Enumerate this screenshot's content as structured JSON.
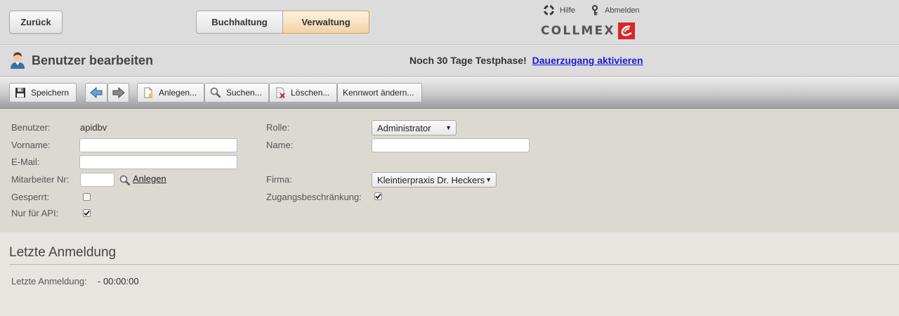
{
  "header": {
    "back_label": "Zurück",
    "tabs": [
      {
        "label": "Buchhaltung",
        "active": false
      },
      {
        "label": "Verwaltung",
        "active": true
      }
    ],
    "help_label": "Hilfe",
    "logout_label": "Abmelden",
    "logo_text": "COLLMEX"
  },
  "titlebar": {
    "title": "Benutzer bearbeiten",
    "trial_text": "Noch 30 Tage Testphase!",
    "trial_link": "Dauerzugang aktivieren"
  },
  "toolbar": {
    "save_label": "Speichern",
    "create_label": "Anlegen...",
    "search_label": "Suchen...",
    "delete_label": "Löschen...",
    "password_label": "Kennwort ändern..."
  },
  "form": {
    "user_label": "Benutzer:",
    "user_value": "apidbv",
    "firstname_label": "Vorname:",
    "firstname_value": "",
    "email_label": "E-Mail:",
    "email_value": "",
    "employee_label": "Mitarbeiter Nr:",
    "employee_value": "",
    "employee_create_link": "Anlegen",
    "locked_label": "Gesperrt:",
    "locked_checked": false,
    "api_only_label": "Nur für API:",
    "api_only_checked": true,
    "role_label": "Rolle:",
    "role_value": "Administrator",
    "name_label": "Name:",
    "name_value": "",
    "company_label": "Firma:",
    "company_value": "Kleintierpraxis Dr. Heckers",
    "access_restriction_label": "Zugangsbeschränkung:",
    "access_restriction_checked": true
  },
  "last_login": {
    "section_title": "Letzte Anmeldung",
    "label": "Letzte Anmeldung:",
    "value": "- 00:00:00"
  },
  "colors": {
    "active_tab": "#f2d3a2",
    "logo_red": "#d7262a",
    "link_blue": "#1a1ad8"
  }
}
